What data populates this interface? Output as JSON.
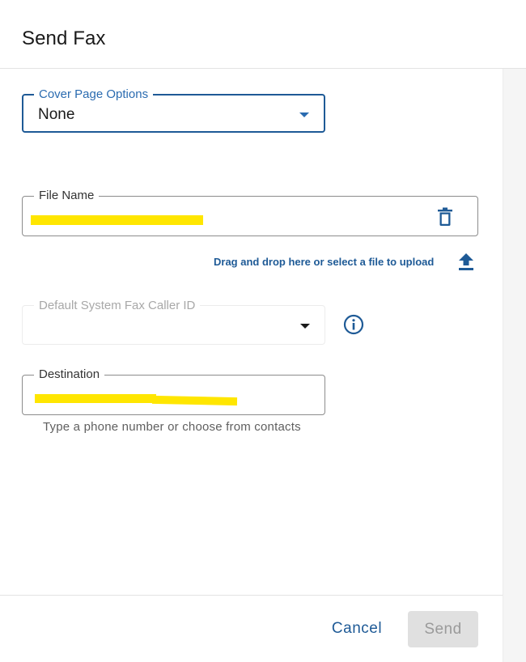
{
  "dialog": {
    "title": "Send Fax"
  },
  "cover_page": {
    "label": "Cover Page Options",
    "value": "None",
    "accent_color": "#1e5a96"
  },
  "file_name": {
    "label": "File Name",
    "value_redacted": true
  },
  "upload": {
    "text": "Drag and drop here or select a file to upload",
    "icon": "upload-icon"
  },
  "caller_id": {
    "label": "Default System Fax Caller ID",
    "value": "",
    "disabled": true
  },
  "destination": {
    "label": "Destination",
    "value_redacted": true,
    "hint": "Type a phone number or choose from contacts"
  },
  "footer": {
    "cancel_label": "Cancel",
    "send_label": "Send",
    "send_disabled": true
  },
  "colors": {
    "primary": "#1e5a96",
    "highlight": "#ffe600",
    "disabled_bg": "#e0e0e0"
  }
}
